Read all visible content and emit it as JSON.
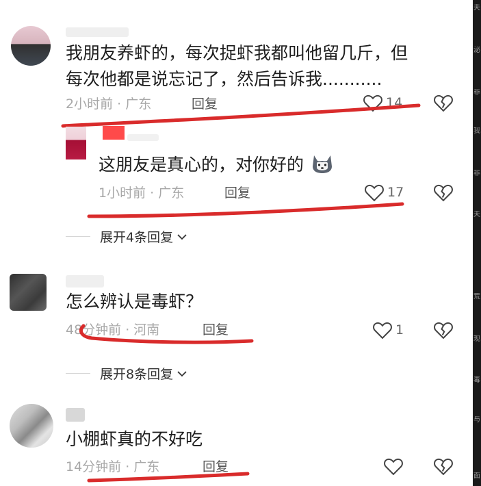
{
  "comments": [
    {
      "text_lines": [
        "我朋友养虾的，每次捉虾我都叫他留几斤，但",
        "每次他都是说忘记了，然后告诉我..........."
      ],
      "meta": "2小时前 · 广东",
      "reply_label": "回复",
      "likes": "14",
      "icons": [
        "heart-outline-icon",
        "broken-heart-icon"
      ]
    },
    {
      "text": "这朋友是真心的，对你好的",
      "emoji": "husky-dog-emoji",
      "meta": "1小时前 · 广东",
      "reply_label": "回复",
      "likes": "17"
    },
    {
      "text": "怎么辨认是毒虾？",
      "meta": "48分钟前 · 河南",
      "reply_label": "回复",
      "likes": "1"
    },
    {
      "text": "小棚虾真的不好吃",
      "meta": "14分钟前 · 广东",
      "reply_label": "回复",
      "likes": ""
    }
  ],
  "expand_1": "展开4条回复",
  "expand_2": "展开8条回复",
  "annotation_color": "#d92b2b",
  "right_strip_chars": [
    "夫",
    "泌",
    "非",
    "我",
    "非",
    "夫",
    "荒",
    "现",
    "毒",
    "与",
    "面"
  ]
}
